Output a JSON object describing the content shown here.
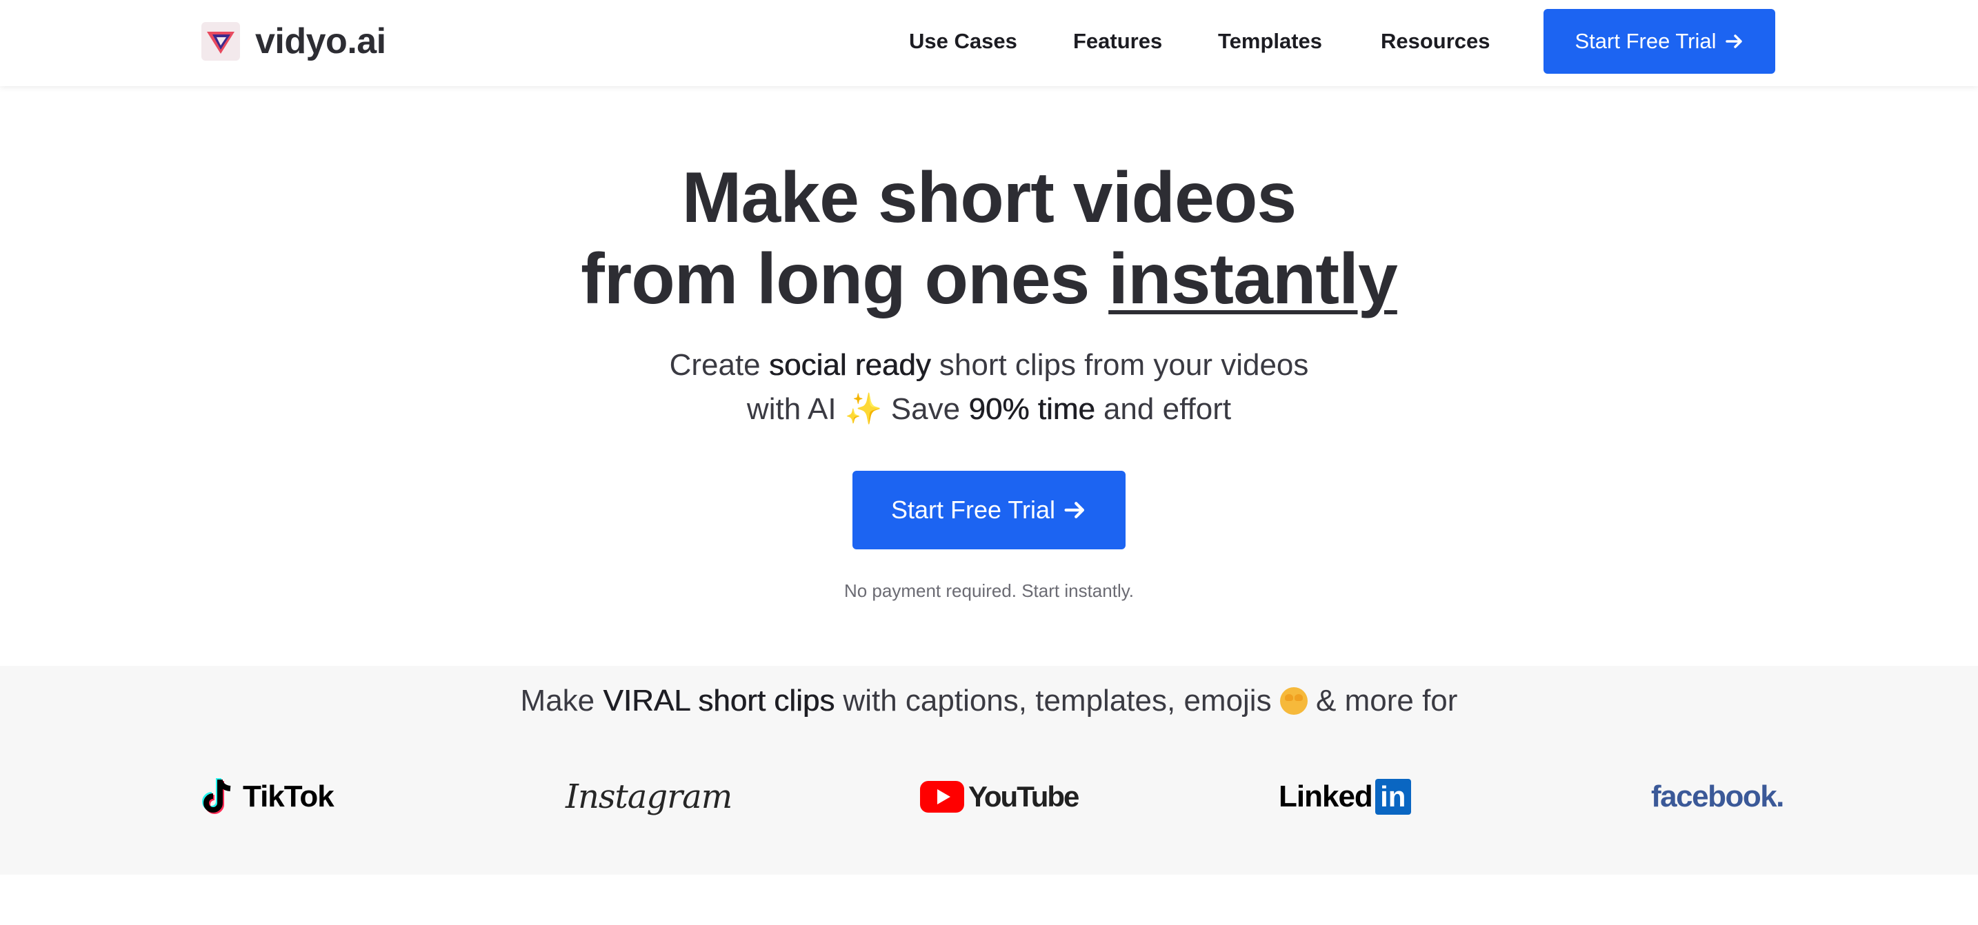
{
  "header": {
    "logo_text": "vidyo.ai",
    "nav": {
      "use_cases": "Use Cases",
      "features": "Features",
      "templates": "Templates",
      "resources": "Resources"
    },
    "cta_label": "Start Free Trial"
  },
  "hero": {
    "title_line1": "Make short videos",
    "title_line2_pre": "from long ones ",
    "title_line2_emph": "instantly",
    "sub_line1_a": "Create ",
    "sub_line1_b": "social ready",
    "sub_line1_c": " short clips from your videos",
    "sub_line2_a": "with AI ",
    "sub_line2_sparkle": "✨",
    "sub_line2_b": " Save ",
    "sub_line2_c": "90% time",
    "sub_line2_d": " and effort",
    "cta_label": "Start Free Trial",
    "note": "No payment required. Start instantly."
  },
  "platforms": {
    "heading_a": "Make ",
    "heading_b": "VIRAL short clips",
    "heading_c": " with captions, templates, emojis ",
    "heading_d": " & more for",
    "brands": {
      "tiktok": "TikTok",
      "instagram": "Instagram",
      "youtube": "YouTube",
      "linkedin_text": "Linked",
      "linkedin_box": "in",
      "facebook": "facebook."
    }
  },
  "colors": {
    "accent": "#1c64f2",
    "text": "#2d2d33",
    "strip_bg": "#f7f7f7",
    "youtube_red": "#ff0000",
    "linkedin_blue": "#0a66c2",
    "facebook_blue": "#3b5998"
  },
  "icons": {
    "logo": "vidyo-triangle-logo",
    "cta_arrow": "arrow-right-icon",
    "emoji": "star-struck-emoji"
  }
}
